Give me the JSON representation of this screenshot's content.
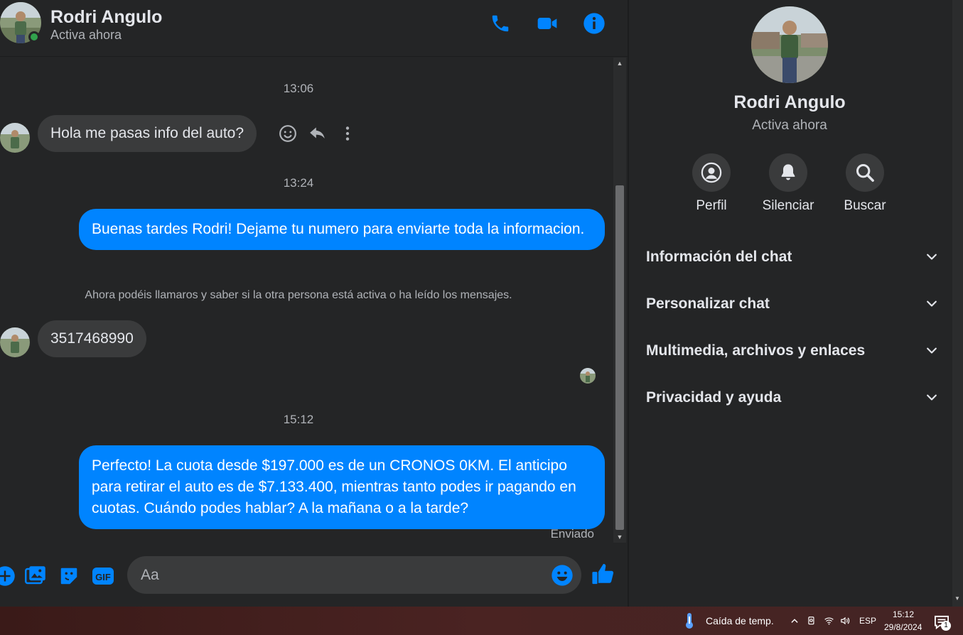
{
  "header": {
    "name": "Rodri Angulo",
    "status": "Activa ahora"
  },
  "messages": {
    "timestamp_1": "13:06",
    "incoming_1": "Hola me pasas info del auto?",
    "timestamp_2": "13:24",
    "outgoing_1": "Buenas tardes Rodri! Dejame tu numero para enviarte toda la informacion.",
    "notice": "Ahora podéis llamaros y saber si la otra persona está activa o ha leído los mensajes.",
    "incoming_2": "3517468990",
    "timestamp_3": "15:12",
    "outgoing_2": "Perfecto! La cuota desde $197.000 es de un CRONOS 0KM. El anticipo para retirar el auto es de $7.133.400, mientras tanto podes ir pagando en cuotas. Cuándo podes hablar? A la mañana o a la tarde?",
    "sent_status": "Enviado"
  },
  "composer": {
    "placeholder": "Aa",
    "gif_label": "GIF"
  },
  "panel": {
    "name": "Rodri Angulo",
    "status": "Activa ahora",
    "actions": [
      {
        "label": "Perfil",
        "icon": "profile-icon"
      },
      {
        "label": "Silenciar",
        "icon": "bell-icon"
      },
      {
        "label": "Buscar",
        "icon": "search-icon"
      }
    ],
    "sections": [
      {
        "label": "Información del chat"
      },
      {
        "label": "Personalizar chat"
      },
      {
        "label": "Multimedia, archivos y enlaces"
      },
      {
        "label": "Privacidad y ayuda"
      }
    ]
  },
  "taskbar": {
    "weather": "Caída de temp.",
    "language": "ESP",
    "time": "15:12",
    "date": "29/8/2024",
    "notification_count": "1"
  },
  "colors": {
    "accent": "#0084ff",
    "background": "#242526",
    "bubble_incoming": "#3a3b3c",
    "online": "#31a24c"
  }
}
